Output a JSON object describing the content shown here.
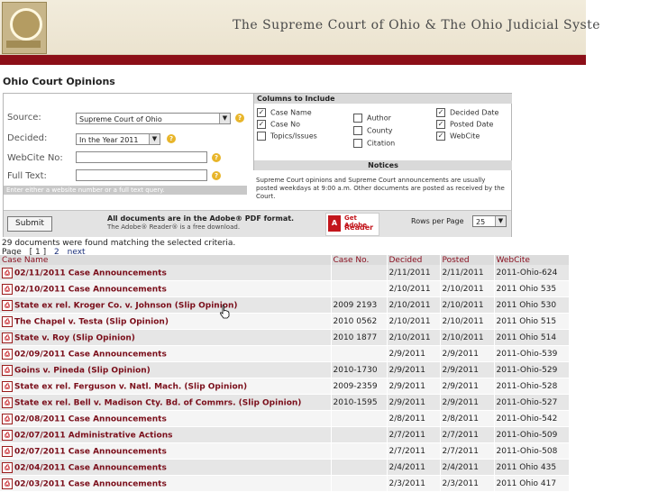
{
  "banner": {
    "title": "The Supreme Court of Ohio & The Ohio Judicial Syste"
  },
  "page_title": "Ohio Court Opinions",
  "form": {
    "source_label": "Source:",
    "source_value": "Supreme Court of Ohio",
    "decided_label": "Decided:",
    "decided_value": "In the Year 2011",
    "webcite_label": "WebCite No:",
    "webcite_value": "",
    "fulltext_label": "Full Text:",
    "fulltext_value": "",
    "hint": "Enter either a website number or a full text query.",
    "submit_label": "Submit"
  },
  "columns": {
    "heading": "Columns to Include",
    "items": [
      {
        "label": "Case Name",
        "checked": true
      },
      {
        "label": "Case No",
        "checked": true
      },
      {
        "label": "Topics/Issues",
        "checked": false
      },
      {
        "label": "Author",
        "checked": false
      },
      {
        "label": "County",
        "checked": false
      },
      {
        "label": "Citation",
        "checked": false
      },
      {
        "label": "Decided Date",
        "checked": true
      },
      {
        "label": "Posted Date",
        "checked": true
      },
      {
        "label": "WebCite",
        "checked": true
      }
    ]
  },
  "notices": {
    "heading": "Notices",
    "text": "Supreme Court opinions and Supreme Court announcements are usually posted weekdays at 9:00 a.m. Other documents are posted as received by the Court."
  },
  "pdf": {
    "line1": "All documents are in the Adobe® PDF format.",
    "line2": "The Adobe® Reader® is a free download.",
    "reader_t1": "Get Adobe",
    "reader_t2": "Reader"
  },
  "rows_per_page": {
    "label": "Rows per Page",
    "value": "25"
  },
  "results": {
    "found": "29 documents were found matching the selected criteria.",
    "pager": {
      "label": "Page",
      "current": "[ 1 ]",
      "p2": "2",
      "next": "next"
    },
    "headers": [
      "Case Name",
      "Case No.",
      "Decided",
      "Posted",
      "WebCite"
    ],
    "rows": [
      [
        "02/11/2011 Case Announcements",
        "",
        "2/11/2011",
        "2/11/2011",
        "2011-Ohio-624"
      ],
      [
        "02/10/2011 Case Announcements",
        "",
        "2/10/2011",
        "2/10/2011",
        "2011 Ohio 535"
      ],
      [
        "State ex rel. Kroger Co. v. Johnson (Slip Opinion)",
        "2009 2193",
        "2/10/2011",
        "2/10/2011",
        "2011 Ohio 530"
      ],
      [
        "The Chapel v. Testa (Slip Opinion)",
        "2010 0562",
        "2/10/2011",
        "2/10/2011",
        "2011 Ohio 515"
      ],
      [
        "State v. Roy (Slip Opinion)",
        "2010 1877",
        "2/10/2011",
        "2/10/2011",
        "2011 Ohio 514"
      ],
      [
        "02/09/2011 Case Announcements",
        "",
        "2/9/2011",
        "2/9/2011",
        "2011-Ohio-539"
      ],
      [
        "Goins v. Pineda (Slip Opinion)",
        "2010-1730",
        "2/9/2011",
        "2/9/2011",
        "2011-Ohio-529"
      ],
      [
        "State ex rel. Ferguson v. Natl. Mach. (Slip Opinion)",
        "2009-2359",
        "2/9/2011",
        "2/9/2011",
        "2011-Ohio-528"
      ],
      [
        "State ex rel. Bell v. Madison Cty. Bd. of Commrs. (Slip Opinion)",
        "2010-1595",
        "2/9/2011",
        "2/9/2011",
        "2011-Ohio-527"
      ],
      [
        "02/08/2011 Case Announcements",
        "",
        "2/8/2011",
        "2/8/2011",
        "2011-Ohio-542"
      ],
      [
        "02/07/2011 Administrative Actions",
        "",
        "2/7/2011",
        "2/7/2011",
        "2011-Ohio-509"
      ],
      [
        "02/07/2011 Case Announcements",
        "",
        "2/7/2011",
        "2/7/2011",
        "2011-Ohio-508"
      ],
      [
        "02/04/2011 Case Announcements",
        "",
        "2/4/2011",
        "2/4/2011",
        "2011 Ohio 435"
      ],
      [
        "02/03/2011 Case Announcements",
        "",
        "2/3/2011",
        "2/3/2011",
        "2011 Ohio 417"
      ]
    ]
  }
}
